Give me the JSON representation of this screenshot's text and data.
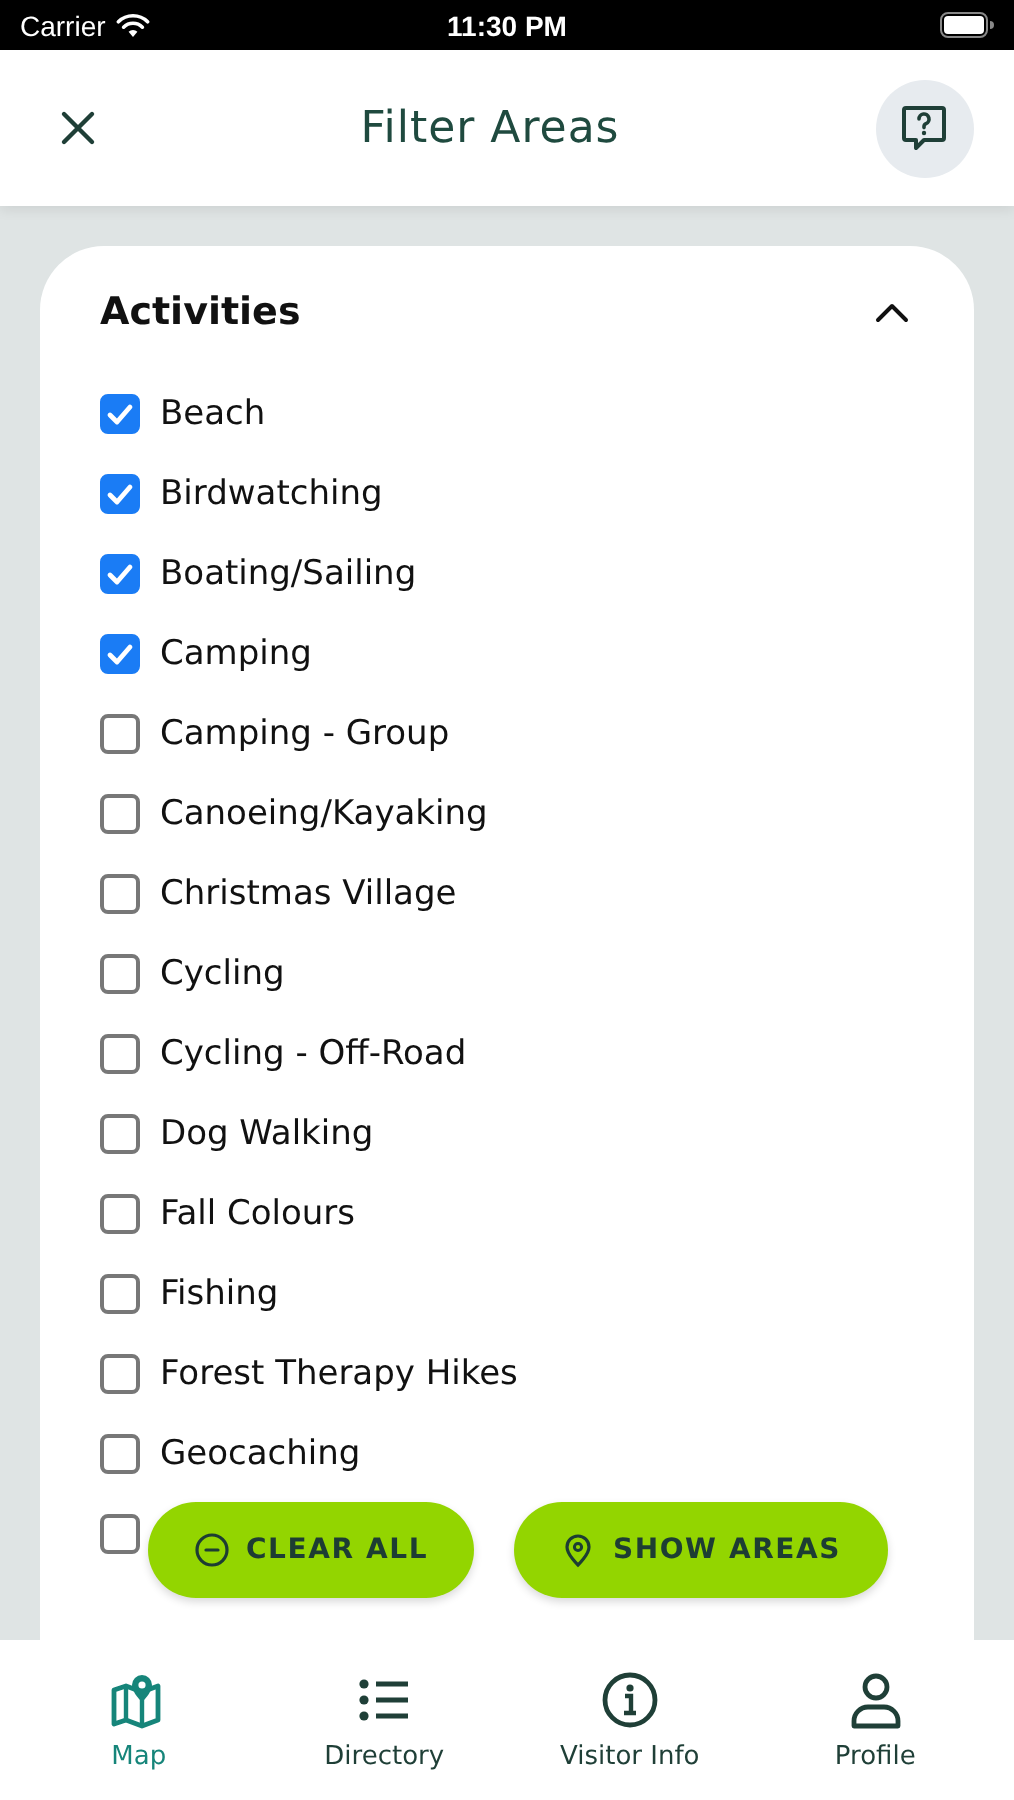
{
  "status_bar": {
    "carrier": "Carrier",
    "time": "11:30 PM"
  },
  "header": {
    "title": "Filter Areas"
  },
  "section": {
    "title": "Activities",
    "expanded": true,
    "items": [
      {
        "label": "Beach",
        "checked": true
      },
      {
        "label": "Birdwatching",
        "checked": true
      },
      {
        "label": "Boating/Sailing",
        "checked": true
      },
      {
        "label": "Camping",
        "checked": true
      },
      {
        "label": "Camping - Group",
        "checked": false
      },
      {
        "label": "Canoeing/Kayaking",
        "checked": false
      },
      {
        "label": "Christmas Village",
        "checked": false
      },
      {
        "label": "Cycling",
        "checked": false
      },
      {
        "label": "Cycling - Off-Road",
        "checked": false
      },
      {
        "label": "Dog Walking",
        "checked": false
      },
      {
        "label": "Fall Colours",
        "checked": false
      },
      {
        "label": "Fishing",
        "checked": false
      },
      {
        "label": "Forest Therapy Hikes",
        "checked": false
      },
      {
        "label": "Geocaching",
        "checked": false
      },
      {
        "checked": false
      }
    ]
  },
  "actions": [
    {
      "label": "CLEAR ALL",
      "kind": "clear"
    },
    {
      "label": "SHOW AREAS",
      "kind": "show"
    }
  ],
  "tabs": [
    {
      "label": "Map",
      "kind": "map",
      "selected": true
    },
    {
      "label": "Directory",
      "kind": "list",
      "selected": false
    },
    {
      "label": "Visitor Info",
      "kind": "info",
      "selected": false
    },
    {
      "label": "Profile",
      "kind": "person",
      "selected": false
    }
  ]
}
